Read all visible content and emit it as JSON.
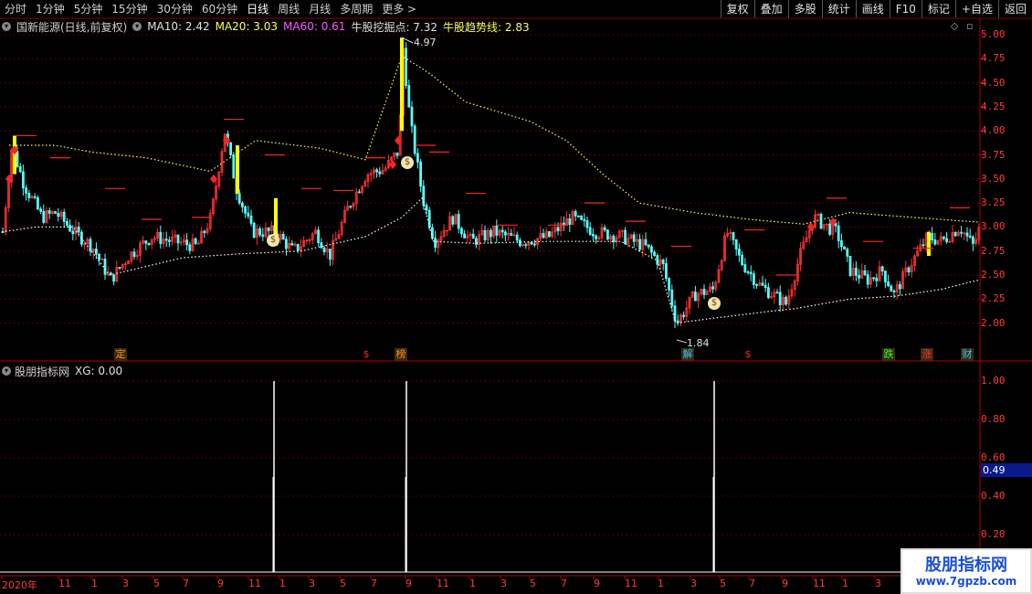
{
  "toolbar": {
    "periods": [
      "分时",
      "1分钟",
      "5分钟",
      "15分钟",
      "30分钟",
      "60分钟",
      "日线",
      "周线",
      "月线",
      "多周期",
      "更多 >"
    ],
    "active": "日线",
    "right_buttons": [
      "复权",
      "叠加",
      "多股",
      "统计",
      "画线",
      "F10",
      "标记",
      "+自选",
      "返回"
    ]
  },
  "main_legend": {
    "title": "国新能源(日线,前复权)",
    "ma10": "MA10: 2.42",
    "ma20": "MA20: 3.03",
    "ma60": "MA60: 0.61",
    "dig": "牛股挖掘点: 7.32",
    "trend": "牛股趋势线: 2.83"
  },
  "sub_legend": {
    "title": "股朋指标网",
    "xg": "XG: 0.00"
  },
  "price_axis": [
    "5.00",
    "4.75",
    "4.50",
    "4.25",
    "4.00",
    "3.75",
    "3.50",
    "3.25",
    "3.00",
    "2.75",
    "2.50",
    "2.25",
    "2.00"
  ],
  "ind_axis": [
    "1.00",
    "0.80",
    "0.60",
    "0.40",
    "0.20"
  ],
  "current_value": "0.49",
  "annotations": {
    "high": "4.97",
    "low": "1.84"
  },
  "event_markers": [
    {
      "label": "定",
      "color": "#ff8c1a"
    },
    {
      "label": "$",
      "color": "#ff2222"
    },
    {
      "label": "榜",
      "color": "#ff8c1a"
    },
    {
      "label": "解",
      "color": "#32c8ff"
    },
    {
      "label": "$",
      "color": "#ff2222"
    },
    {
      "label": "跌",
      "color": "#33ff33"
    },
    {
      "label": "涨",
      "color": "#ff3333"
    },
    {
      "label": "财",
      "color": "#32c8ff"
    }
  ],
  "x_axis": [
    "2020年",
    "11",
    "1",
    "3",
    "5",
    "7",
    "9",
    "11",
    "1",
    "3",
    "5",
    "7",
    "9",
    "11",
    "1",
    "3",
    "5",
    "7",
    "9",
    "11",
    "1",
    "3",
    "5",
    "7",
    "9",
    "11",
    "1",
    "3"
  ],
  "watermark": {
    "title": "股朋指标网",
    "url": "www.7gpzb.com"
  },
  "colors": {
    "up": "#ff3232",
    "down": "#54ffff",
    "trend": "#ffff55",
    "lower": "#ffffff",
    "signal_yellow": "#ffff00"
  },
  "icons": [
    "collapse-icon",
    "diamond-icon",
    "money-bag-icon",
    "buy-arrow-icon"
  ]
}
